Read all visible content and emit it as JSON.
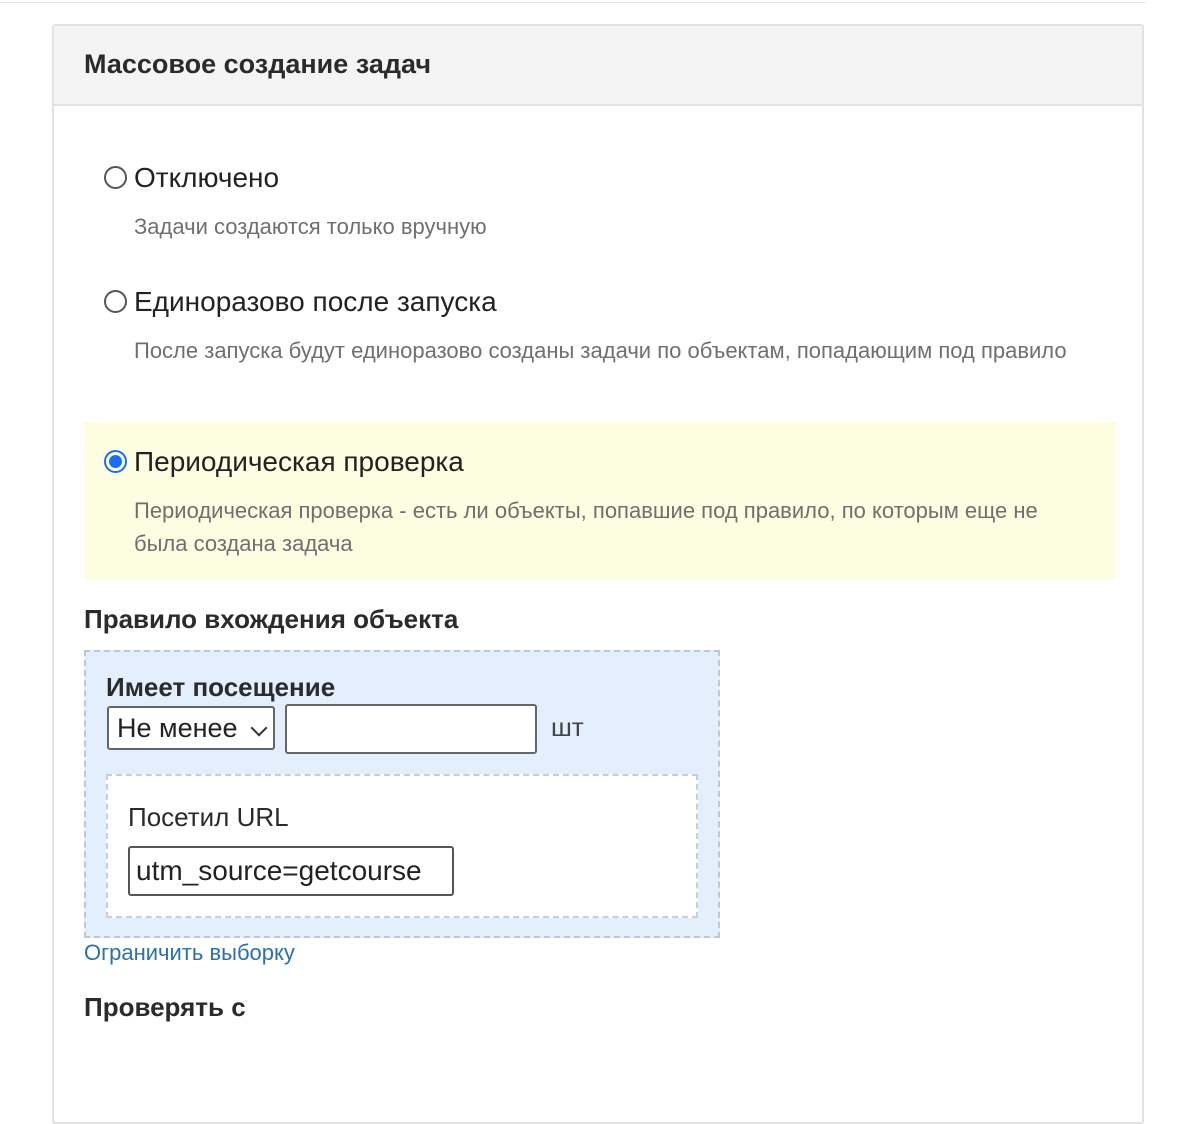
{
  "panel": {
    "title": "Массовое создание задач"
  },
  "options": [
    {
      "label": "Отключено",
      "description": "Задачи создаются только вручную",
      "selected": false
    },
    {
      "label": "Единоразово после запуска",
      "description": "После запуска будут единоразово созданы задачи по объектам, попадающим под правило",
      "selected": false
    },
    {
      "label": "Периодическая проверка",
      "description": "Периодическая проверка - есть ли объекты, попавшие под правило, по которым еще не была создана задача",
      "selected": true
    }
  ],
  "rule": {
    "section_title": "Правило вхождения объекта",
    "condition_title": "Имеет посещение",
    "comparator": {
      "selected": "Не менее"
    },
    "count_value": "",
    "unit": "шт",
    "sub_condition": {
      "label": "Посетил URL",
      "value": "utm_source=getcourse"
    },
    "limit_link": "Ограничить выборку"
  },
  "check_from": {
    "title": "Проверять с"
  },
  "colors": {
    "selected_bg": "#fdfde2",
    "rule_bg": "#e3effc",
    "radio_accent": "#1a6ef5",
    "link": "#2a6fb0"
  }
}
